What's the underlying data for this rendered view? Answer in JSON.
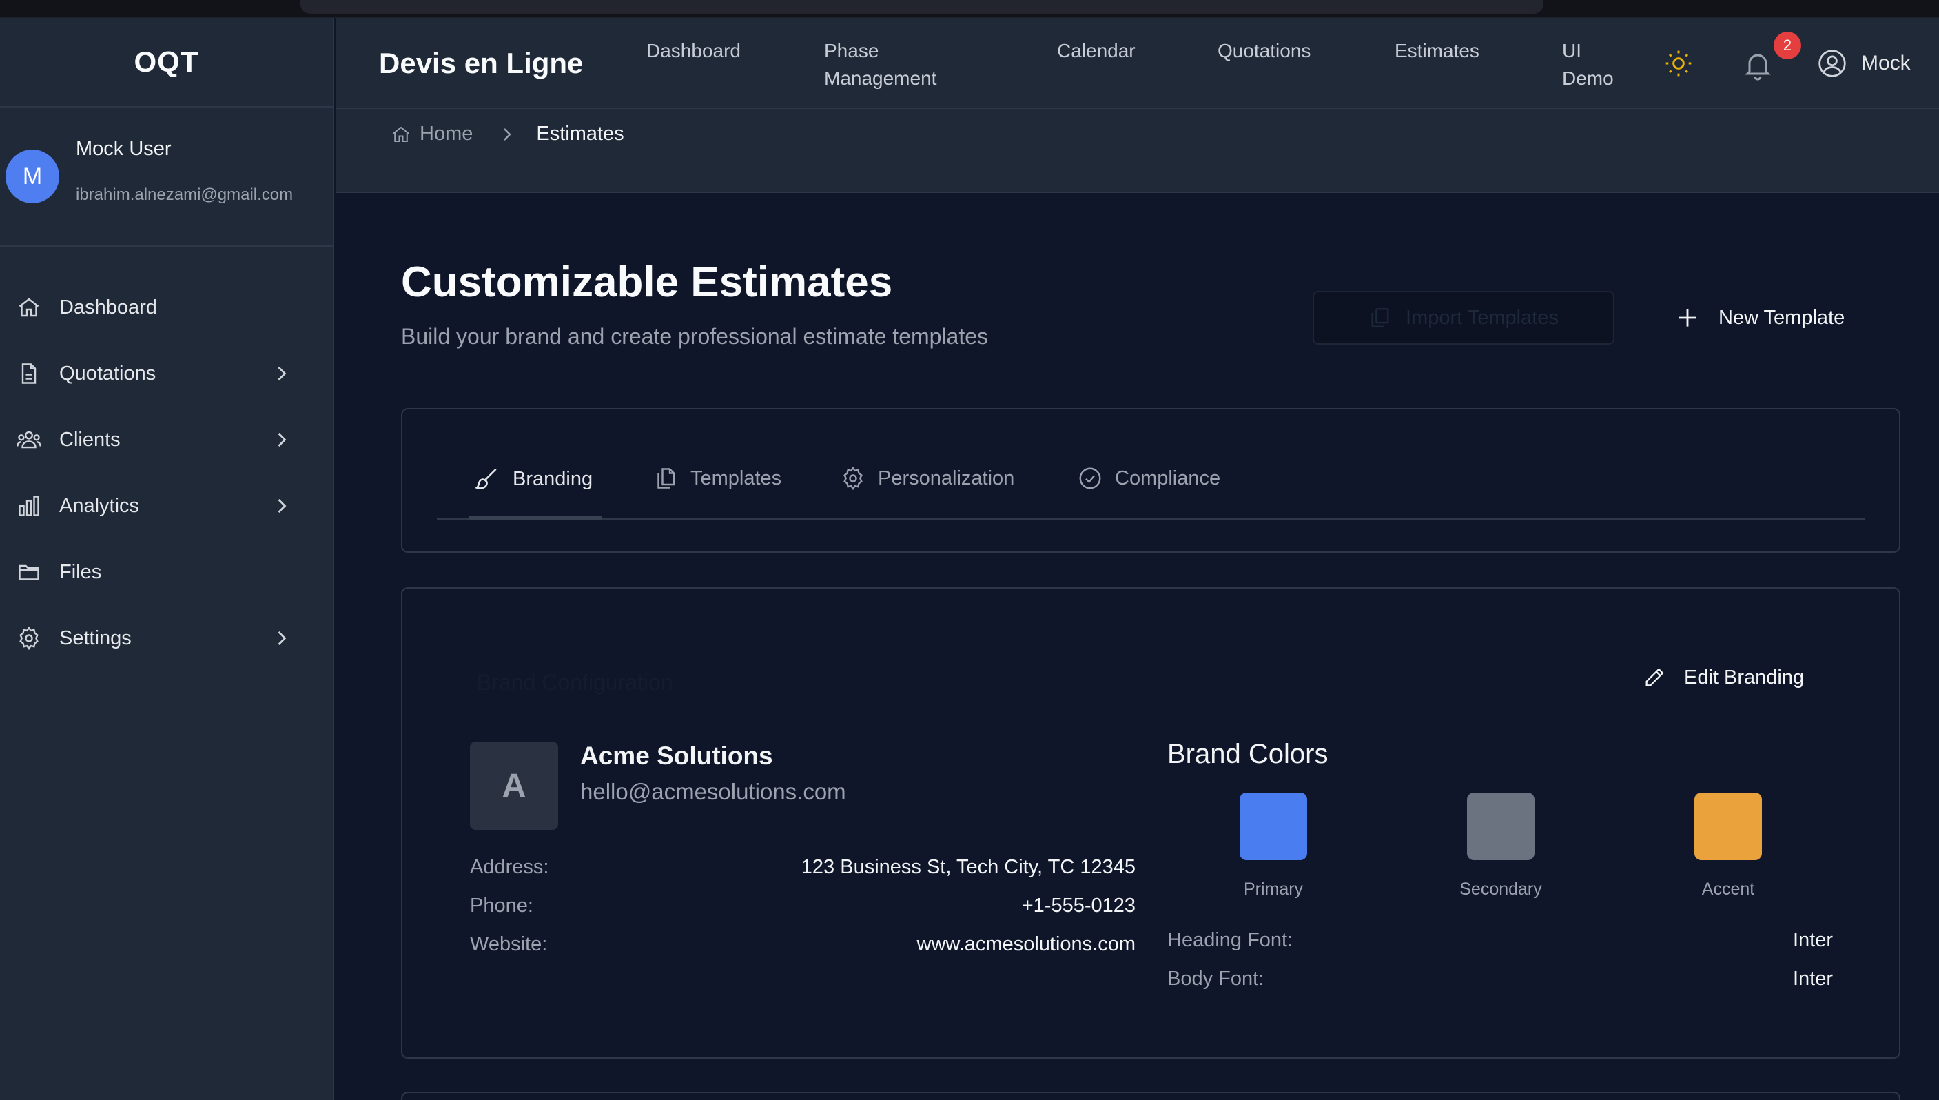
{
  "sidebar": {
    "brand": "OQT",
    "user": {
      "initial": "M",
      "name": "Mock User",
      "email": "ibrahim.alnezami@gmail.com"
    },
    "items": [
      {
        "label": "Dashboard",
        "icon": "home-icon",
        "has_submenu": false
      },
      {
        "label": "Quotations",
        "icon": "document-icon",
        "has_submenu": true
      },
      {
        "label": "Clients",
        "icon": "users-icon",
        "has_submenu": true
      },
      {
        "label": "Analytics",
        "icon": "bar-chart-icon",
        "has_submenu": true
      },
      {
        "label": "Files",
        "icon": "folder-icon",
        "has_submenu": false
      },
      {
        "label": "Settings",
        "icon": "gear-icon",
        "has_submenu": true
      }
    ]
  },
  "header": {
    "title": "Devis en Ligne",
    "nav": [
      {
        "line1": "Dashboard",
        "line2": ""
      },
      {
        "line1": "Phase",
        "line2": "Management"
      },
      {
        "line1": "Calendar",
        "line2": ""
      },
      {
        "line1": "Quotations",
        "line2": ""
      },
      {
        "line1": "Estimates",
        "line2": ""
      },
      {
        "line1": "UI",
        "line2": "Demo"
      }
    ],
    "notification_count": "2",
    "profile_name": "Mock"
  },
  "breadcrumb": {
    "home": "Home",
    "current": "Estimates"
  },
  "page": {
    "title": "Customizable Estimates",
    "subtitle": "Build your brand and create professional estimate templates",
    "import_label": "Import Templates",
    "new_label": "New Template"
  },
  "tabs": [
    {
      "label": "Branding",
      "icon": "brush-icon",
      "active": true
    },
    {
      "label": "Templates",
      "icon": "copy-icon",
      "active": false
    },
    {
      "label": "Personalization",
      "icon": "gear-icon",
      "active": false
    },
    {
      "label": "Compliance",
      "icon": "check-circle-icon",
      "active": false
    }
  ],
  "branding": {
    "section_heading": "Brand Configuration",
    "edit_label": "Edit Branding",
    "logo_initial": "A",
    "company_name": "Acme Solutions",
    "company_email": "hello@acmesolutions.com",
    "info": [
      {
        "label": "Address:",
        "value": "123 Business St, Tech City, TC 12345"
      },
      {
        "label": "Phone:",
        "value": "+1-555-0123"
      },
      {
        "label": "Website:",
        "value": "www.acmesolutions.com"
      }
    ],
    "colors_title": "Brand Colors",
    "colors": [
      {
        "label": "Primary",
        "hex": "#4a7ef0"
      },
      {
        "label": "Secondary",
        "hex": "#6b7280"
      },
      {
        "label": "Accent",
        "hex": "#eaa23c"
      }
    ],
    "fonts": [
      {
        "label": "Heading Font:",
        "value": "Inter"
      },
      {
        "label": "Body Font:",
        "value": "Inter"
      }
    ]
  },
  "theme": {
    "accent_sun": "#eab308",
    "badge": "#e53e3e"
  }
}
